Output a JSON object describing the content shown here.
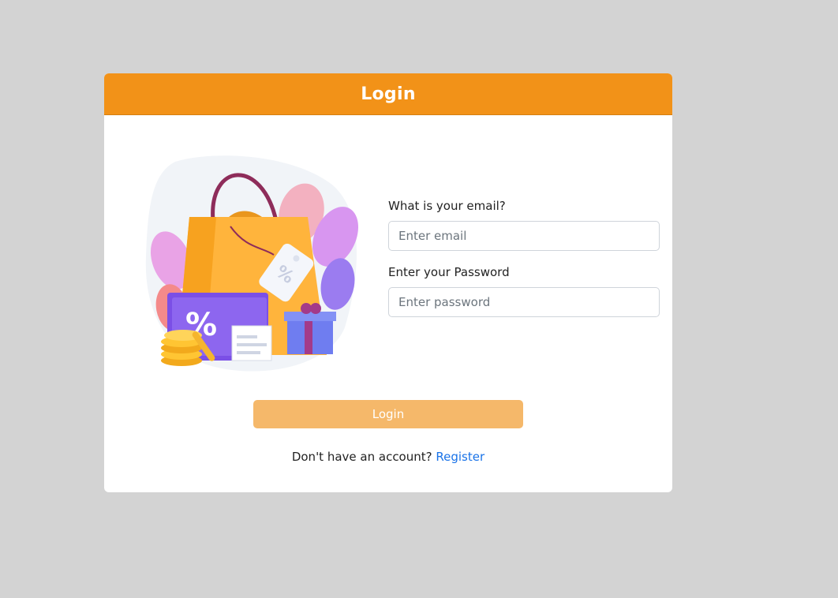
{
  "header": {
    "title": "Login",
    "color": "#f29218"
  },
  "illustration": {
    "icon": "shopping-bag-sale-illustration",
    "tag_text": "%",
    "card_text": "%"
  },
  "form": {
    "email_label": "What is your email?",
    "email_placeholder": "Enter email",
    "email_value": "",
    "password_label": "Enter your Password",
    "password_placeholder": "Enter password",
    "password_value": ""
  },
  "actions": {
    "login_label": "Login",
    "login_color": "#f5b86a",
    "register_prompt": "Don't have an account?",
    "register_link": "Register",
    "link_color": "#1a73e8"
  }
}
